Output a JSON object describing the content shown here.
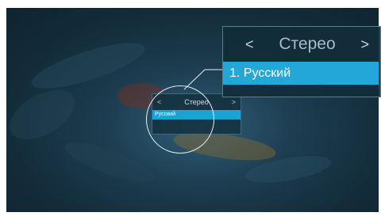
{
  "audio_menu": {
    "title": "Стерео",
    "prev_arrow": "<",
    "next_arrow": ">",
    "selected_item": "1. Русский"
  },
  "small_menu": {
    "title": "Стерео",
    "prev_arrow": "<",
    "next_arrow": ">",
    "selected_item": "Русский"
  },
  "colors": {
    "highlight": "#1aa3d4",
    "background": "#132c3a"
  },
  "icons": [
    "chevron-left-icon",
    "chevron-right-icon"
  ]
}
